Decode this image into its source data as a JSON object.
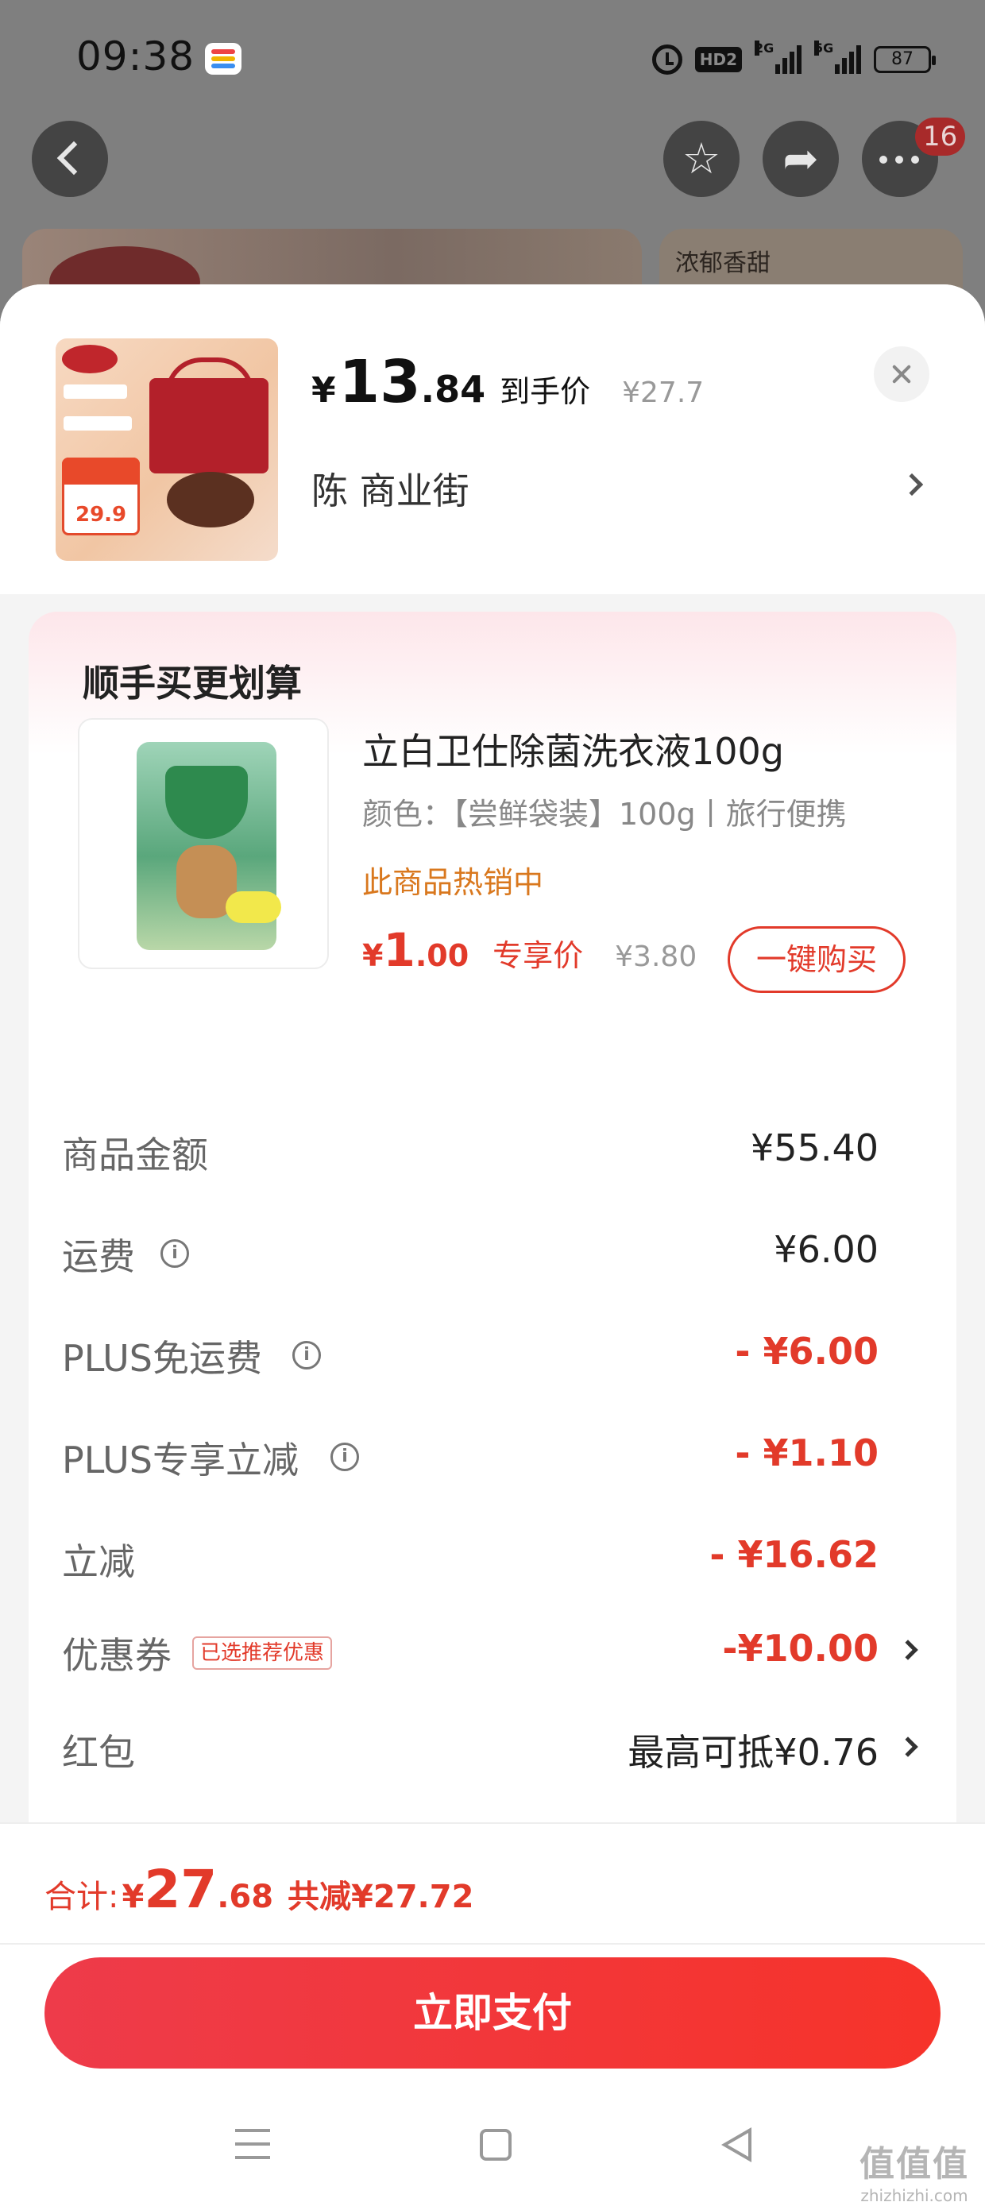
{
  "status_bar": {
    "time": "09:38",
    "hd": "HD2",
    "net1": "2G",
    "net2": "5G",
    "battery": "87"
  },
  "top_nav": {
    "cart_badge": "16"
  },
  "background": {
    "banner_text": "浓郁香甜"
  },
  "header": {
    "price_yen": "¥",
    "price_int": "13",
    "price_dec": ".84",
    "price_label": "到手价",
    "original_price": "¥27.7",
    "address": "陈  商业街"
  },
  "upsell": {
    "title": "顺手买更划算",
    "product_name": "立白卫仕除菌洗衣液100g",
    "spec": "颜色：【尝鲜袋装】100g丨旅行便携",
    "hot_text": "此商品热销中",
    "price_yen": "¥",
    "price_int": "1",
    "price_dec": ".00",
    "price_label": "专享价",
    "original_price": "¥3.80",
    "buy_label": "一键购买"
  },
  "fees": {
    "goods_label": "商品金额",
    "goods_value": "¥55.40",
    "shipping_label": "运费",
    "shipping_value": "¥6.00",
    "plus_free_label": "PLUS免运费",
    "plus_free_value": "- ¥6.00",
    "plus_discount_label": "PLUS专享立减",
    "plus_discount_value": "- ¥1.10",
    "instant_label": "立减",
    "instant_value": "- ¥16.62",
    "coupon_label": "优惠券",
    "coupon_tag": "已选推荐优惠",
    "coupon_value": "-¥10.00",
    "redpacket_label": "红包",
    "redpacket_value": "最高可抵¥0.76"
  },
  "total": {
    "label": "合计:",
    "yen": "¥",
    "int": "27",
    "dec": ".68",
    "saved": "共减¥27.72",
    "pay_label": "立即支付"
  },
  "watermark": {
    "big": "值值值",
    "small": "zhizhizhi.com"
  },
  "colors": {
    "accent_red": "#e23a2a",
    "hot_orange": "#d9781e",
    "pay_gradient_start": "#ee3b4a",
    "pay_gradient_end": "#f6332a"
  },
  "icons": [
    "back-icon",
    "star-icon",
    "share-icon",
    "more-icon",
    "close-icon",
    "chevron-right-icon",
    "info-icon",
    "menu-icon",
    "home-icon",
    "nav-back-icon"
  ]
}
